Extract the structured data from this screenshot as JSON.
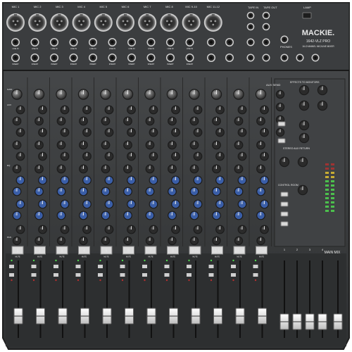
{
  "brand": {
    "name": "MACKIE.",
    "model": "1642-VLZ PRO",
    "subtitle": "16-CHANNEL MIC/LINE MIXER"
  },
  "top_labels": {
    "tape_in": "TAPE IN",
    "tape_out": "TAPE OUT",
    "lamp": "LAMP",
    "phones": "PHONES"
  },
  "mic_labels": [
    "MIC 1",
    "MIC 2",
    "MIC 3",
    "MIC 4",
    "MIC 5",
    "MIC 6",
    "MIC 7",
    "MIC 8",
    "MIC 9-10",
    "MIC 11-12"
  ],
  "jack_labels": {
    "line_in": "LINE IN",
    "insert": "INSERT"
  },
  "strip": {
    "mute_label": "MUTE",
    "channel_numbers": [
      "1",
      "2",
      "3",
      "4",
      "5",
      "6",
      "7",
      "8",
      "9-10",
      "11-12",
      "13-14",
      "15-16"
    ],
    "knob_labels": {
      "gain": "GAIN",
      "aux": "AUX",
      "eq": "EQ",
      "pan": "PAN"
    }
  },
  "master": {
    "aux_send": "AUX SEND",
    "effects_to_monitors": "EFFECTS TO MONITORS",
    "stereo_aux_return": "STEREO AUX RETURN",
    "control_room": "CONTROL ROOM",
    "main_mix": "MAIN MIX",
    "sub_numbers": [
      "1",
      "2",
      "3",
      "4"
    ]
  },
  "colors": {
    "body": "#3d3f40",
    "panel": "#4a4c4e",
    "knob_blue": "#3a5ea8",
    "knob_green": "#3d8a3d",
    "knob_red": "#b03030",
    "cap_white": "#e9e9e9",
    "led_green": "#4fd64f"
  }
}
